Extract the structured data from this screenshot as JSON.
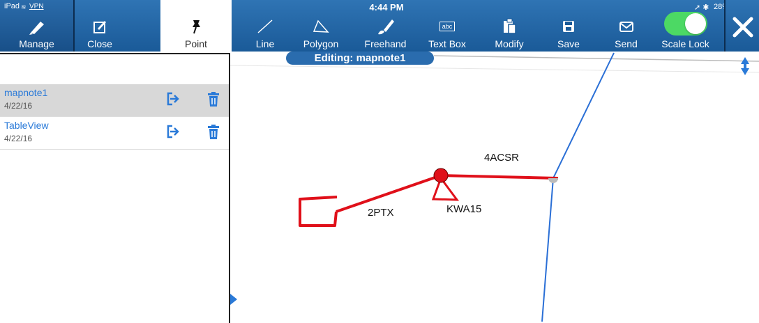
{
  "status_bar": {
    "device": "iPad",
    "vpn": "VPN",
    "time": "4:44 PM",
    "battery": "28%"
  },
  "toolbar": {
    "manage": "Manage",
    "close": "Close",
    "point": "Point",
    "line": "Line",
    "polygon": "Polygon",
    "freehand": "Freehand",
    "textbox": "Text Box",
    "textbox_icon_text": "abc",
    "modify": "Modify",
    "save": "Save",
    "send": "Send",
    "scale_lock": "Scale Lock"
  },
  "scale_lock_on": true,
  "editing_label": "Editing: mapnote1",
  "sidebar": {
    "items": [
      {
        "name": "mapnote1",
        "date": "4/22/16",
        "selected": true
      },
      {
        "name": "TableView",
        "date": "4/22/16",
        "selected": false
      }
    ]
  },
  "map": {
    "labels": {
      "conductor": "4ACSR",
      "transformer": "2PTX",
      "device": "KWA15"
    }
  },
  "colors": {
    "toolbar": "#1f63a4",
    "accent": "#2a7ad8",
    "markup": "#e0101a",
    "line": "#2a6fd6",
    "toggle": "#4cd964"
  }
}
